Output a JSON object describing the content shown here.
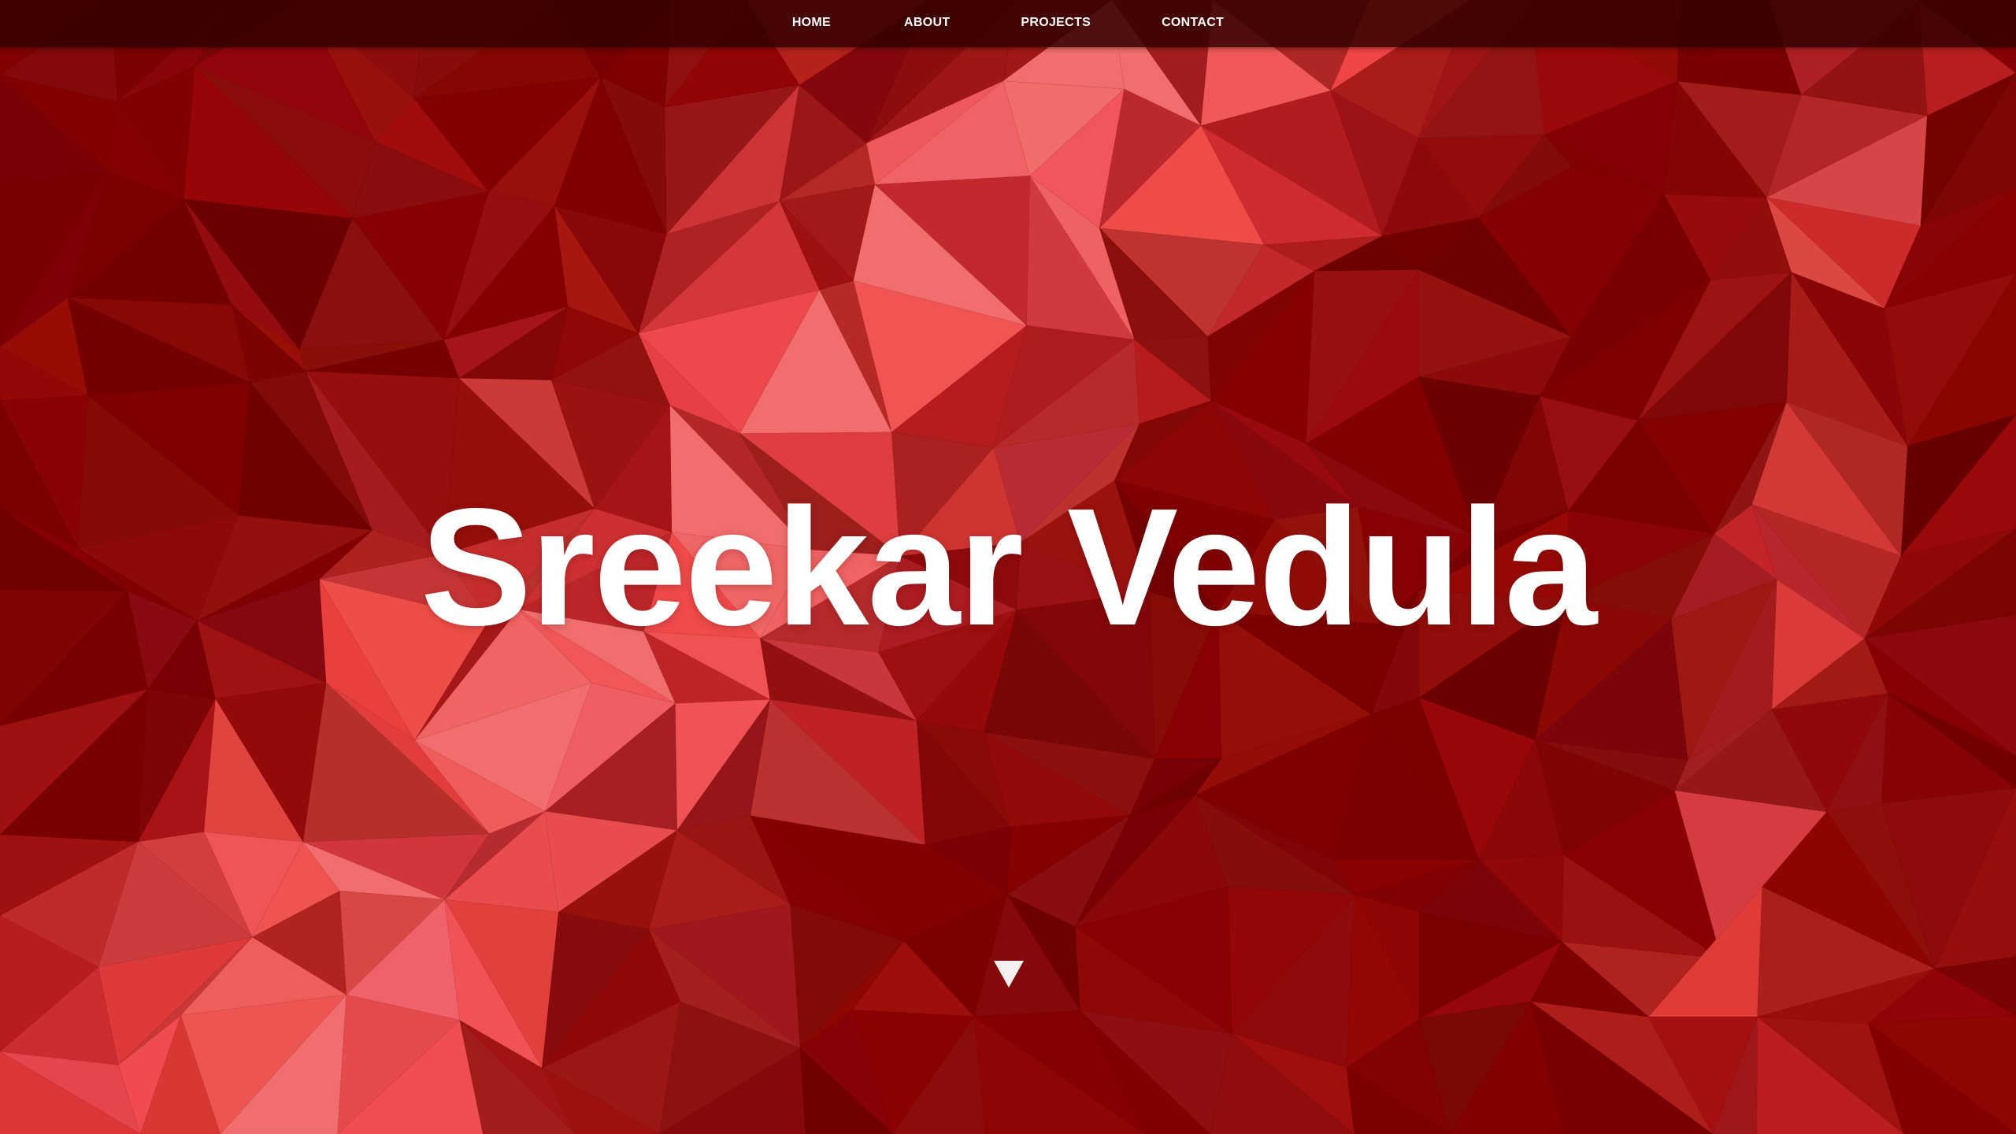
{
  "nav": {
    "items": [
      {
        "label": "HOME"
      },
      {
        "label": "ABOUT"
      },
      {
        "label": "PROJECTS"
      },
      {
        "label": "CONTACT"
      }
    ]
  },
  "hero": {
    "title": "Sreekar Vedula",
    "scroll_icon": "triangle-down-icon"
  },
  "colors": {
    "background": "#8a0000",
    "navbar": "#320000",
    "text": "#ffffff",
    "highlight": "#e86060"
  }
}
